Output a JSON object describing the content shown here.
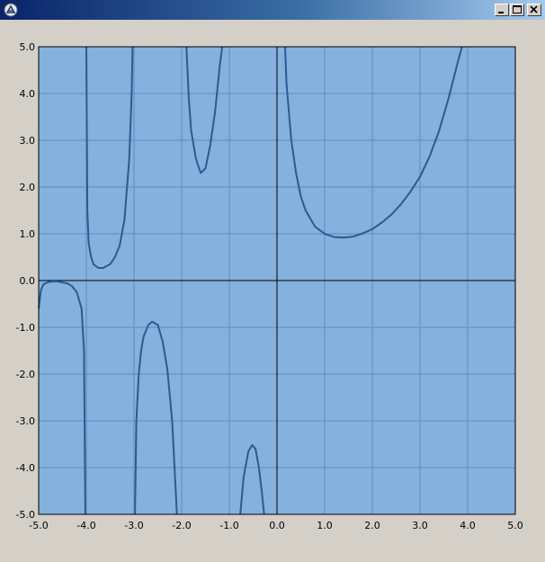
{
  "window": {
    "title": "",
    "buttons": [
      "minimize-button",
      "maximize-button",
      "close-button"
    ]
  },
  "colors": {
    "window_bg": "#d4d0c8",
    "plot_bg": "#84b1dd",
    "grid": "#5f8cbf",
    "axis": "#000000",
    "curve": "#2c5a94"
  },
  "chart_data": {
    "type": "line",
    "title": "",
    "xlabel": "",
    "ylabel": "",
    "xlim": [
      -5.0,
      5.0
    ],
    "ylim": [
      -5.0,
      5.0
    ],
    "grid": true,
    "legend": "none",
    "x_ticks": [
      "-5.0",
      "-4.0",
      "-3.0",
      "-2.0",
      "-1.0",
      "0.0",
      "1.0",
      "2.0",
      "3.0",
      "4.0",
      "5.0"
    ],
    "y_ticks": [
      "5.0",
      "4.0",
      "3.0",
      "2.0",
      "1.0",
      "0.0",
      "-1.0",
      "-2.0",
      "-3.0",
      "-4.0",
      "-5.0"
    ],
    "series": [
      {
        "segments": [
          [
            [
              -5.0,
              -0.6
            ],
            [
              -4.95,
              -0.2
            ],
            [
              -4.9,
              -0.08
            ],
            [
              -4.8,
              -0.03
            ],
            [
              -4.7,
              -0.02
            ],
            [
              -4.6,
              -0.02
            ],
            [
              -4.5,
              -0.04
            ],
            [
              -4.4,
              -0.06
            ],
            [
              -4.3,
              -0.12
            ],
            [
              -4.2,
              -0.25
            ],
            [
              -4.1,
              -0.6
            ],
            [
              -4.05,
              -1.5
            ],
            [
              -4.02,
              -5.0
            ]
          ],
          [
            [
              -4.0,
              5.0
            ],
            [
              -3.98,
              1.5
            ],
            [
              -3.95,
              0.8
            ],
            [
              -3.9,
              0.5
            ],
            [
              -3.85,
              0.35
            ],
            [
              -3.75,
              0.27
            ],
            [
              -3.65,
              0.27
            ],
            [
              -3.5,
              0.35
            ],
            [
              -3.4,
              0.5
            ],
            [
              -3.3,
              0.75
            ],
            [
              -3.2,
              1.3
            ],
            [
              -3.1,
              2.6
            ],
            [
              -3.05,
              4.0
            ],
            [
              -3.03,
              5.0
            ]
          ],
          [
            [
              -2.98,
              -5.0
            ],
            [
              -2.95,
              -3.0
            ],
            [
              -2.9,
              -2.0
            ],
            [
              -2.85,
              -1.5
            ],
            [
              -2.8,
              -1.2
            ],
            [
              -2.7,
              -0.95
            ],
            [
              -2.62,
              -0.88
            ],
            [
              -2.5,
              -0.95
            ],
            [
              -2.4,
              -1.3
            ],
            [
              -2.3,
              -1.9
            ],
            [
              -2.2,
              -3.0
            ],
            [
              -2.15,
              -4.0
            ],
            [
              -2.1,
              -5.0
            ]
          ],
          [
            [
              -1.9,
              5.0
            ],
            [
              -1.85,
              3.9
            ],
            [
              -1.8,
              3.2
            ],
            [
              -1.7,
              2.6
            ],
            [
              -1.6,
              2.3
            ],
            [
              -1.5,
              2.4
            ],
            [
              -1.4,
              2.9
            ],
            [
              -1.3,
              3.6
            ],
            [
              -1.2,
              4.6
            ],
            [
              -1.15,
              5.0
            ]
          ],
          [
            [
              -0.77,
              -5.0
            ],
            [
              -0.7,
              -4.2
            ],
            [
              -0.6,
              -3.65
            ],
            [
              -0.52,
              -3.52
            ],
            [
              -0.45,
              -3.6
            ],
            [
              -0.38,
              -4.0
            ],
            [
              -0.32,
              -4.5
            ],
            [
              -0.27,
              -5.0
            ]
          ],
          [
            [
              0.17,
              5.0
            ],
            [
              0.2,
              4.2
            ],
            [
              0.3,
              3.0
            ],
            [
              0.4,
              2.3
            ],
            [
              0.5,
              1.8
            ],
            [
              0.6,
              1.5
            ],
            [
              0.8,
              1.15
            ],
            [
              1.0,
              1.0
            ],
            [
              1.2,
              0.93
            ],
            [
              1.4,
              0.92
            ],
            [
              1.6,
              0.94
            ],
            [
              1.8,
              1.01
            ],
            [
              2.0,
              1.1
            ],
            [
              2.2,
              1.24
            ],
            [
              2.4,
              1.41
            ],
            [
              2.6,
              1.63
            ],
            [
              2.8,
              1.9
            ],
            [
              3.0,
              2.22
            ],
            [
              3.2,
              2.65
            ],
            [
              3.4,
              3.2
            ],
            [
              3.6,
              3.9
            ],
            [
              3.8,
              4.7
            ],
            [
              3.88,
              5.0
            ]
          ]
        ]
      }
    ]
  }
}
